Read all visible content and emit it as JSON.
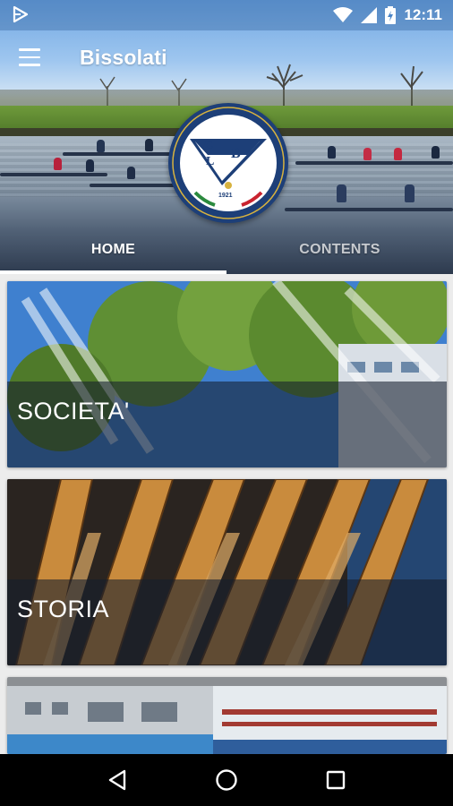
{
  "status_bar": {
    "time": "12:11",
    "icons": [
      "play-store-notification-icon",
      "wifi-icon",
      "cellular-signal-icon",
      "battery-charging-icon"
    ]
  },
  "toolbar": {
    "title": "Bissolati",
    "menu_icon": "hamburger-menu-icon"
  },
  "logo": {
    "letters": [
      "C",
      "L",
      "B"
    ],
    "year": "1921"
  },
  "tabs": [
    {
      "label": "HOME",
      "active": true
    },
    {
      "label": "CONTENTS",
      "active": false
    }
  ],
  "cards": [
    {
      "label": "SOCIETA'"
    },
    {
      "label": "STORIA"
    },
    {
      "label": ""
    }
  ],
  "navbar": {
    "icons": [
      "back-icon",
      "home-circle-icon",
      "recents-square-icon"
    ]
  },
  "colors": {
    "accent": "#ffffff",
    "logo_navy": "#1d3f78",
    "logo_gold": "#d7b23f"
  }
}
